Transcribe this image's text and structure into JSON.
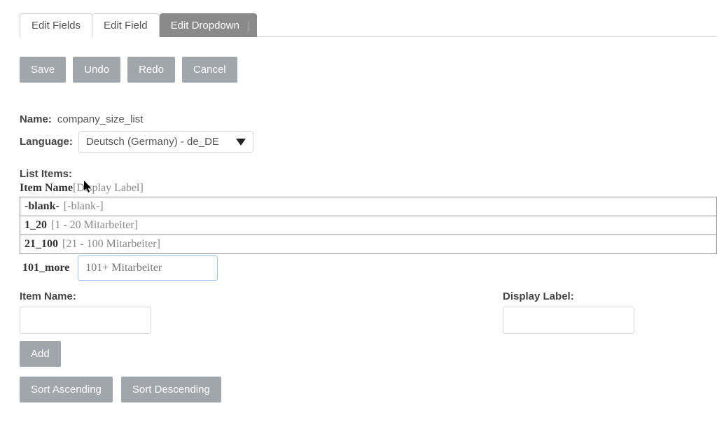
{
  "tabs": [
    {
      "label": "Edit Fields",
      "active": false
    },
    {
      "label": "Edit Field",
      "active": false
    },
    {
      "label": "Edit Dropdown",
      "active": true
    }
  ],
  "actions": {
    "save": "Save",
    "undo": "Undo",
    "redo": "Redo",
    "cancel": "Cancel"
  },
  "fields": {
    "name_label": "Name:",
    "name_value": "company_size_list",
    "language_label": "Language:",
    "language_value": "Deutsch (Germany) - de_DE"
  },
  "list": {
    "header": "List Items:",
    "col_name": "Item Name",
    "col_label": "[Display Label]",
    "rows": [
      {
        "name": "-blank-",
        "label": "[-blank-]",
        "editing": false
      },
      {
        "name": "1_20",
        "label": "[1 - 20 Mitarbeiter]",
        "editing": false
      },
      {
        "name": "21_100",
        "label": "[21 - 100 Mitarbeiter]",
        "editing": false
      },
      {
        "name": "101_more",
        "label": "101+ Mitarbeiter",
        "editing": true
      }
    ]
  },
  "bottom": {
    "item_name_label": "Item Name:",
    "display_label_label": "Display Label:",
    "add": "Add",
    "sort_asc": "Sort Ascending",
    "sort_desc": "Sort Descending"
  }
}
